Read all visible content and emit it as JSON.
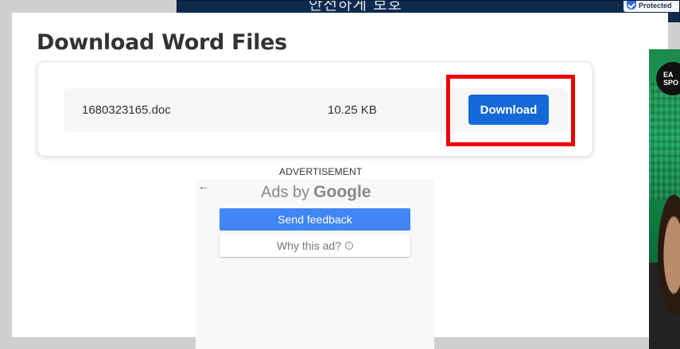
{
  "top_banner": {
    "text": "안전하게 보호",
    "protected_label": "Protected"
  },
  "side_ad": {
    "logo_text_line1": "EA",
    "logo_text_line2": "SPO"
  },
  "page": {
    "title": "Download Word Files"
  },
  "file": {
    "name": "1680323165.doc",
    "size": "10.25 KB",
    "download_label": "Download"
  },
  "advertisement": {
    "label": "ADVERTISEMENT",
    "ads_by": "Ads by",
    "google": "Google",
    "send_feedback": "Send feedback",
    "why_this_ad": "Why this ad?",
    "back_icon": "←",
    "info_icon": "i"
  },
  "colors": {
    "primary_button": "#1468d8",
    "highlight_border": "#ee0000",
    "feedback_button": "#4285f4"
  }
}
